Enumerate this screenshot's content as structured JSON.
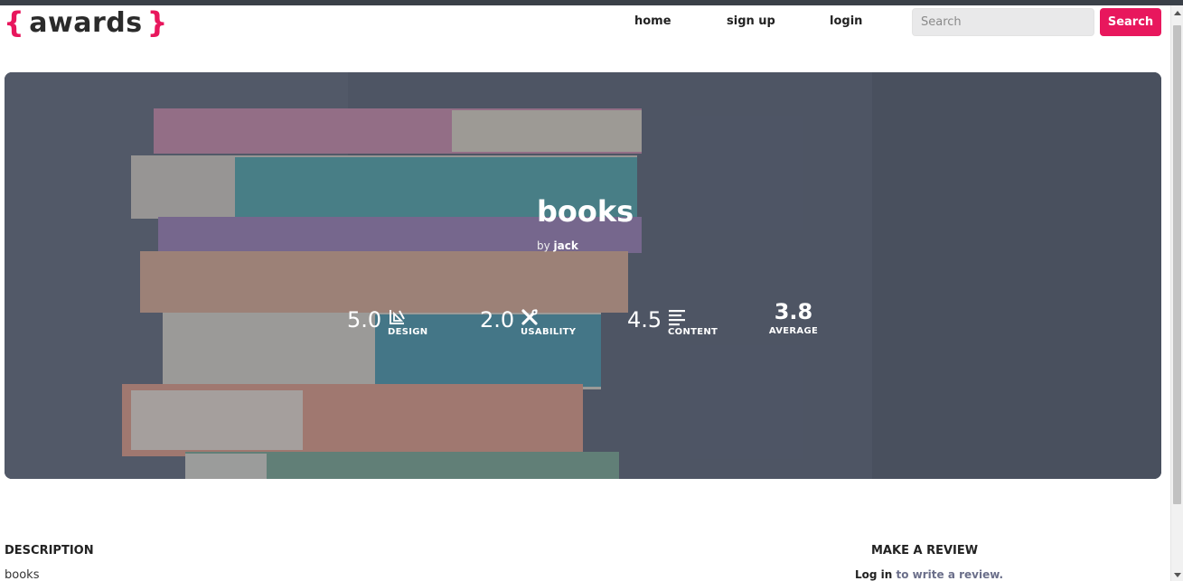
{
  "brand": {
    "open_brace": "{",
    "name": "awards",
    "close_brace": "}",
    "accent": "#e8175d"
  },
  "nav": {
    "home": "home",
    "signup": "sign up",
    "login": "login"
  },
  "search": {
    "placeholder": "Search",
    "button": "Search"
  },
  "project": {
    "title": "books",
    "by_prefix": "by",
    "author": "jack",
    "scores": {
      "design": {
        "value": "5.0",
        "label": "DESIGN",
        "icon": "drafting-tools-icon"
      },
      "usability": {
        "value": "2.0",
        "label": "USABILITY",
        "icon": "tools-icon"
      },
      "content": {
        "value": "4.5",
        "label": "CONTENT",
        "icon": "text-lines-icon"
      },
      "average": {
        "value": "3.8",
        "label": "AVERAGE"
      }
    }
  },
  "description": {
    "heading": "DESCRIPTION",
    "text": "books"
  },
  "review": {
    "heading": "MAKE A REVIEW",
    "login_link": "Log in",
    "suffix": " to write a review."
  }
}
